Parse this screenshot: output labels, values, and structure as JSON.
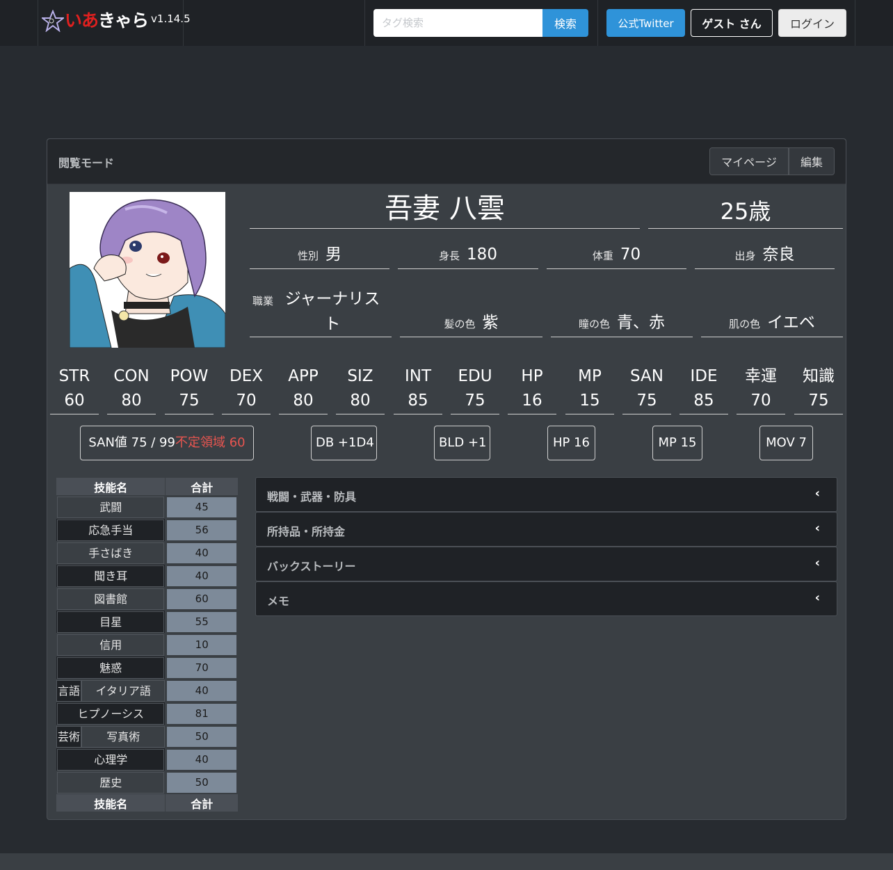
{
  "nav": {
    "logo_part1": "いあ",
    "logo_part2": "きゃら",
    "version": "v1.14.5",
    "search_placeholder": "タグ検索",
    "search_label": "検索",
    "twitter_label": "公式Twitter",
    "guest_label": "ゲスト さん",
    "login_label": "ログイン"
  },
  "header": {
    "mode": "閲覧モード",
    "mypage_label": "マイページ",
    "edit_label": "編集"
  },
  "character": {
    "name": "吾妻 八雲",
    "age": "25歳",
    "profile": [
      {
        "label": "性別",
        "value": "男"
      },
      {
        "label": "身長",
        "value": "180"
      },
      {
        "label": "体重",
        "value": "70"
      },
      {
        "label": "出身",
        "value": "奈良"
      },
      {
        "label": "職業",
        "value": "ジャーナリスト"
      },
      {
        "label": "髪の色",
        "value": "紫"
      },
      {
        "label": "瞳の色",
        "value": "青、赤"
      },
      {
        "label": "肌の色",
        "value": "イエベ"
      }
    ]
  },
  "stats": [
    {
      "name": "STR",
      "value": "60"
    },
    {
      "name": "CON",
      "value": "80"
    },
    {
      "name": "POW",
      "value": "75"
    },
    {
      "name": "DEX",
      "value": "70"
    },
    {
      "name": "APP",
      "value": "80"
    },
    {
      "name": "SIZ",
      "value": "80"
    },
    {
      "name": "INT",
      "value": "85"
    },
    {
      "name": "EDU",
      "value": "75"
    },
    {
      "name": "HP",
      "value": "16"
    },
    {
      "name": "MP",
      "value": "15"
    },
    {
      "name": "SAN",
      "value": "75"
    },
    {
      "name": "IDE",
      "value": "85"
    },
    {
      "name": "幸運",
      "value": "70"
    },
    {
      "name": "知識",
      "value": "75"
    }
  ],
  "derived": {
    "san": "SAN値 75 / 99",
    "san_warn": "不定領域 60",
    "db": "DB +1D4",
    "bld": "BLD +1",
    "hp": "HP 16",
    "mp": "MP 15",
    "mov": "MOV 7"
  },
  "skills": {
    "col_name": "技能名",
    "col_total": "合計",
    "rows": [
      {
        "name": "武闘",
        "value": "45"
      },
      {
        "name": "応急手当",
        "value": "56"
      },
      {
        "name": "手さばき",
        "value": "40"
      },
      {
        "name": "聞き耳",
        "value": "40"
      },
      {
        "name": "図書館",
        "value": "60"
      },
      {
        "name": "目星",
        "value": "55"
      },
      {
        "name": "信用",
        "value": "10"
      },
      {
        "name": "魅惑",
        "value": "70"
      },
      {
        "category": "言語",
        "name": "イタリア語",
        "value": "40"
      },
      {
        "name": "ヒプノーシス",
        "value": "81"
      },
      {
        "category": "芸術",
        "name": "写真術",
        "value": "50"
      },
      {
        "name": "心理学",
        "value": "40"
      },
      {
        "name": "歴史",
        "value": "50"
      }
    ]
  },
  "sections": [
    {
      "title": "戦闘・武器・防具"
    },
    {
      "title": "所持品・所持金"
    },
    {
      "title": "バックストーリー"
    },
    {
      "title": "メモ"
    }
  ],
  "colors": {
    "accent": "#2f93d9",
    "warning": "#e85550",
    "skill_value_bg": "#7d8a99"
  }
}
